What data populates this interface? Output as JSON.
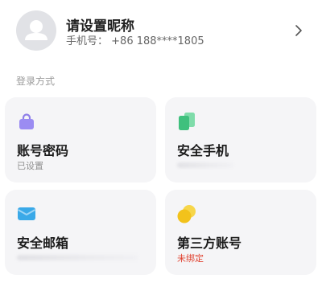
{
  "profile": {
    "nickname": "请设置昵称",
    "phone_label": "手机号：",
    "phone_value": "+86 188****1805"
  },
  "section": {
    "label": "登录方式"
  },
  "cards": [
    {
      "title": "账号密码",
      "status": "已设置",
      "icon": "lock-icon",
      "color": "#9b8cf2"
    },
    {
      "title": "安全手机",
      "status": "",
      "icon": "phone-icon",
      "color": "#4cc987"
    },
    {
      "title": "安全邮箱",
      "status": "",
      "icon": "mail-icon",
      "color": "#3aa9e8"
    },
    {
      "title": "第三方账号",
      "status": "未绑定",
      "icon": "coins-icon",
      "color": "#f2c21b"
    }
  ],
  "colors": {
    "card_bg": "#f5f5f7",
    "unbound_red": "#e0412f"
  }
}
